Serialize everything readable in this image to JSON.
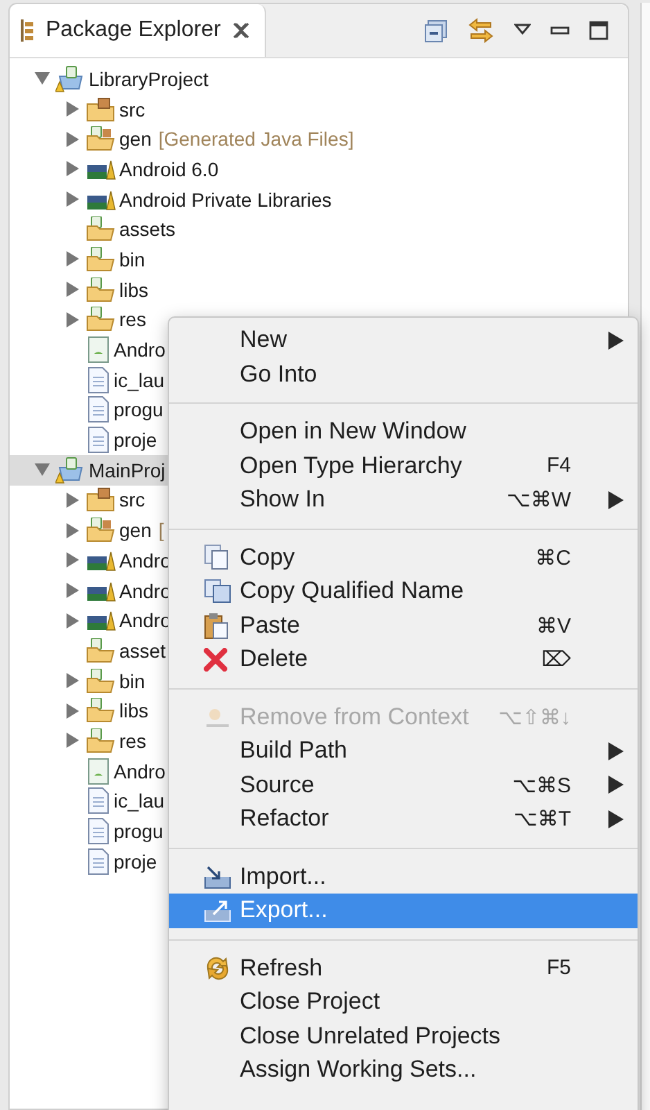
{
  "view": {
    "title": "Package Explorer"
  },
  "tree": [
    {
      "label": "LibraryProject",
      "kind": "project",
      "expanded": true,
      "selected": false,
      "children": [
        {
          "label": "src",
          "kind": "package-folder",
          "expanded": false,
          "selected": false
        },
        {
          "label": "gen",
          "note": "[Generated Java Files]",
          "kind": "source-folder",
          "expanded": false,
          "selected": false
        },
        {
          "label": "Android 6.0",
          "kind": "library",
          "expanded": false,
          "selected": false
        },
        {
          "label": "Android Private Libraries",
          "kind": "library",
          "expanded": false,
          "selected": false
        },
        {
          "label": "assets",
          "kind": "folder",
          "selected": false
        },
        {
          "label": "bin",
          "kind": "folder",
          "expanded": false,
          "selected": false
        },
        {
          "label": "libs",
          "kind": "folder",
          "expanded": false,
          "selected": false
        },
        {
          "label": "res",
          "kind": "folder",
          "expanded": false,
          "selected": false
        },
        {
          "label": "Andro",
          "kind": "manifest",
          "selected": false
        },
        {
          "label": "ic_lau",
          "kind": "file",
          "selected": false
        },
        {
          "label": "progu",
          "kind": "file",
          "selected": false
        },
        {
          "label": "proje",
          "kind": "file",
          "selected": false
        }
      ]
    },
    {
      "label": "MainProj",
      "kind": "project",
      "expanded": true,
      "selected": true,
      "children": [
        {
          "label": "src",
          "kind": "package-folder",
          "expanded": false,
          "selected": false
        },
        {
          "label": "gen",
          "note": "[",
          "kind": "source-folder",
          "expanded": false,
          "selected": false
        },
        {
          "label": "Andro",
          "kind": "library",
          "expanded": false,
          "selected": false
        },
        {
          "label": "Andro",
          "kind": "library",
          "expanded": false,
          "selected": false
        },
        {
          "label": "Andro",
          "kind": "library",
          "expanded": false,
          "selected": false
        },
        {
          "label": "asset",
          "kind": "folder",
          "selected": false
        },
        {
          "label": "bin",
          "kind": "folder",
          "expanded": false,
          "selected": false
        },
        {
          "label": "libs",
          "kind": "folder",
          "expanded": false,
          "selected": false
        },
        {
          "label": "res",
          "kind": "folder",
          "expanded": false,
          "selected": false
        },
        {
          "label": "Andro",
          "kind": "manifest",
          "selected": false
        },
        {
          "label": "ic_lau",
          "kind": "file",
          "selected": false
        },
        {
          "label": "progu",
          "kind": "file",
          "selected": false
        },
        {
          "label": "proje",
          "kind": "file",
          "selected": false
        }
      ]
    }
  ],
  "context_menu": {
    "groups": [
      [
        {
          "label": "New",
          "kind": "plain",
          "submenu": true,
          "disabled": false,
          "selected": false
        },
        {
          "label": "Go Into",
          "kind": "plain",
          "submenu": false,
          "disabled": false,
          "selected": false
        }
      ],
      [
        {
          "label": "Open in New Window",
          "kind": "plain",
          "submenu": false,
          "disabled": false,
          "selected": false
        },
        {
          "label": "Open Type Hierarchy",
          "kind": "plain",
          "shortcut": "F4",
          "submenu": false,
          "disabled": false,
          "selected": false
        },
        {
          "label": "Show In",
          "kind": "plain",
          "shortcut": "⌥⌘W",
          "submenu": true,
          "disabled": false,
          "selected": false
        }
      ],
      [
        {
          "label": "Copy",
          "kind": "copy",
          "shortcut": "⌘C",
          "submenu": false,
          "disabled": false,
          "selected": false
        },
        {
          "label": "Copy Qualified Name",
          "kind": "copy-qualified",
          "submenu": false,
          "disabled": false,
          "selected": false
        },
        {
          "label": "Paste",
          "kind": "paste",
          "shortcut": "⌘V",
          "submenu": false,
          "disabled": false,
          "selected": false
        },
        {
          "label": "Delete",
          "kind": "delete",
          "shortcut": "⌦",
          "submenu": false,
          "disabled": false,
          "selected": false
        }
      ],
      [
        {
          "label": "Remove from Context",
          "kind": "remove",
          "shortcut": "⌥⇧⌘↓",
          "submenu": false,
          "disabled": true,
          "selected": false
        },
        {
          "label": "Build Path",
          "kind": "plain",
          "submenu": true,
          "disabled": false,
          "selected": false
        },
        {
          "label": "Source",
          "kind": "plain",
          "shortcut": "⌥⌘S",
          "submenu": true,
          "disabled": false,
          "selected": false
        },
        {
          "label": "Refactor",
          "kind": "plain",
          "shortcut": "⌥⌘T",
          "submenu": true,
          "disabled": false,
          "selected": false
        }
      ],
      [
        {
          "label": "Import...",
          "kind": "import",
          "submenu": false,
          "disabled": false,
          "selected": false
        },
        {
          "label": "Export...",
          "kind": "export",
          "submenu": false,
          "disabled": false,
          "selected": true
        }
      ],
      [
        {
          "label": "Refresh",
          "kind": "refresh",
          "shortcut": "F5",
          "submenu": false,
          "disabled": false,
          "selected": false
        },
        {
          "label": "Close Project",
          "kind": "plain",
          "submenu": false,
          "disabled": false,
          "selected": false
        },
        {
          "label": "Close Unrelated Projects",
          "kind": "plain",
          "submenu": false,
          "disabled": false,
          "selected": false
        },
        {
          "label": "Assign Working Sets...",
          "kind": "plain",
          "submenu": false,
          "disabled": false,
          "selected": false
        }
      ]
    ]
  }
}
